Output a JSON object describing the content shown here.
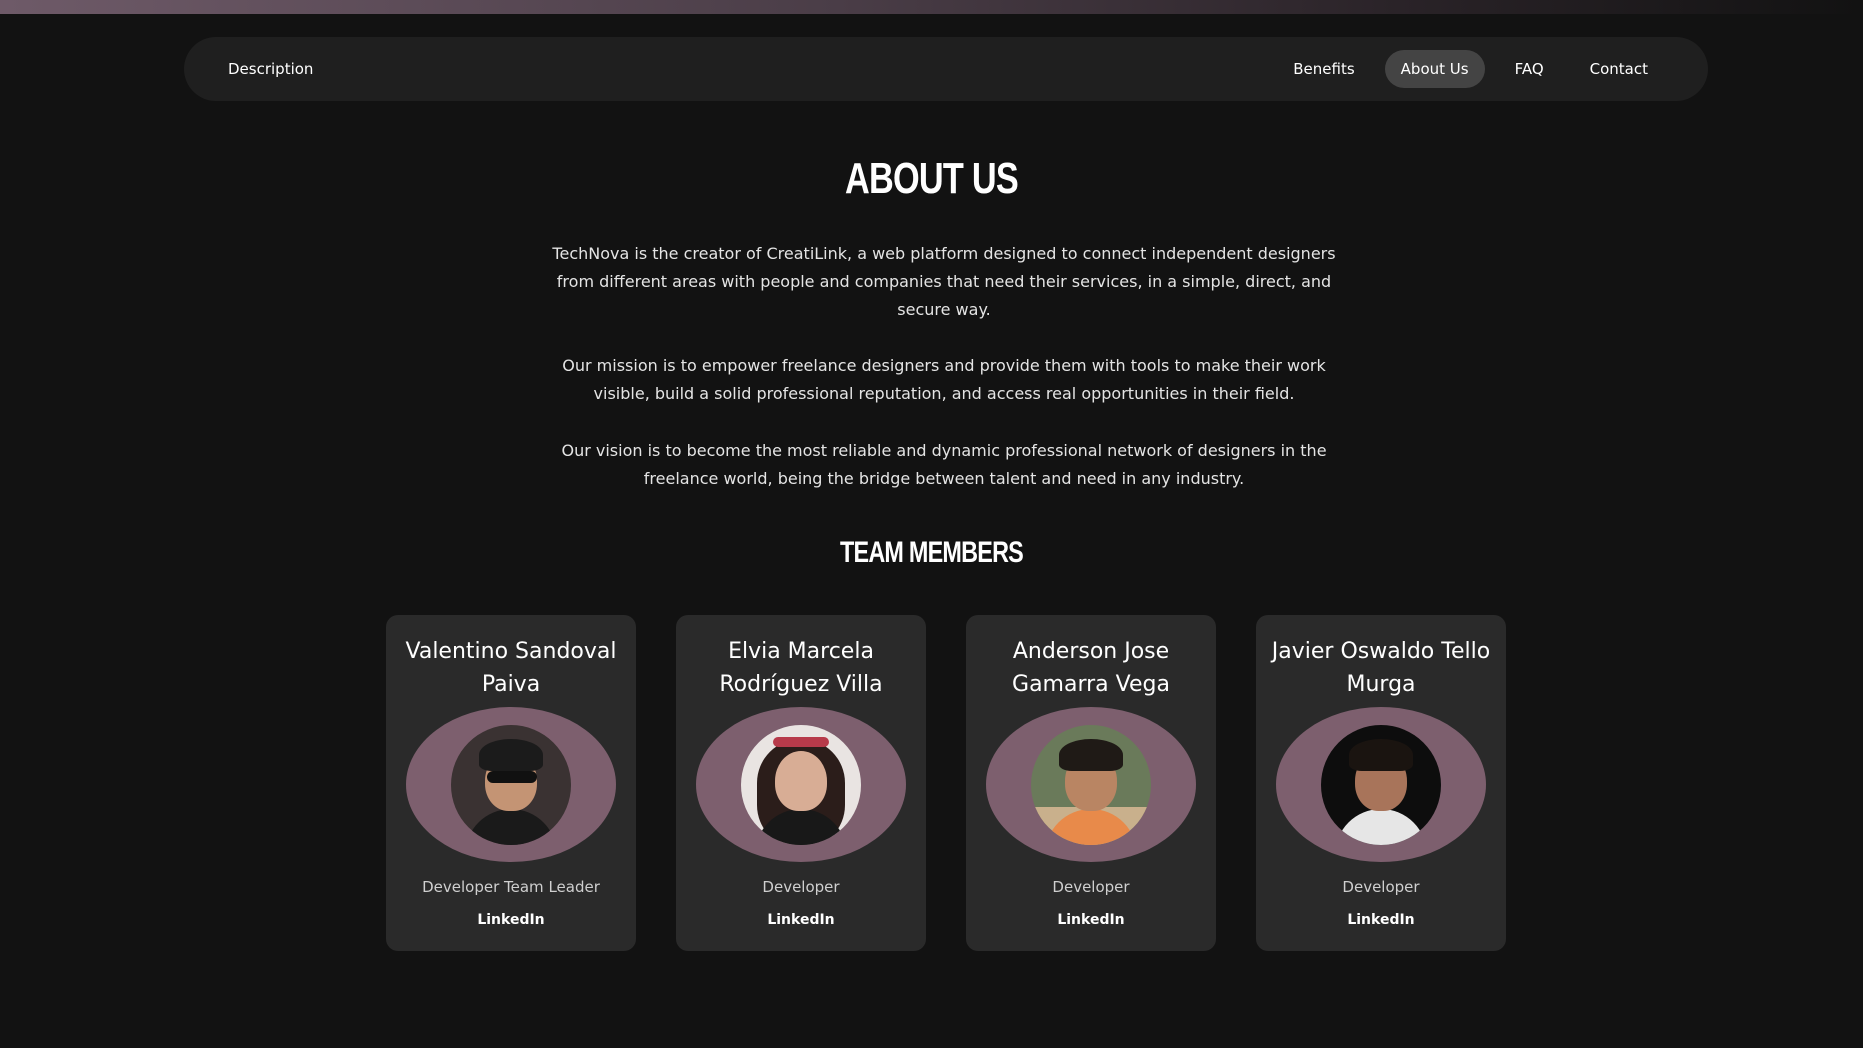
{
  "nav": {
    "left_label": "Description",
    "items": [
      {
        "label": "Benefits"
      },
      {
        "label": "About Us",
        "active": true
      },
      {
        "label": "FAQ"
      },
      {
        "label": "Contact"
      }
    ]
  },
  "about": {
    "title": "ABOUT US",
    "paragraphs": [
      "TechNova is the creator of CreatiLink, a web platform designed to connect independent designers from different areas with people and companies that need their services, in a simple, direct, and secure way.",
      "Our mission is to empower freelance designers and provide them with tools to make their work visible, build a solid professional reputation, and access real opportunities in their field.",
      "Our vision is to become the most reliable and dynamic professional network of designers in the freelance world, being the bridge between talent and need in any industry."
    ]
  },
  "team": {
    "title": "TEAM MEMBERS",
    "members": [
      {
        "name": "Valentino Sandoval Paiva",
        "role": "Developer Team Leader",
        "link": "LinkedIn"
      },
      {
        "name": "Elvia Marcela Rodríguez Villa",
        "role": "Developer",
        "link": "LinkedIn"
      },
      {
        "name": "Anderson Jose Gamarra Vega",
        "role": "Developer",
        "link": "LinkedIn"
      },
      {
        "name": "Javier Oswaldo Tello Murga",
        "role": "Developer",
        "link": "LinkedIn"
      }
    ]
  },
  "colors": {
    "background": "#121212",
    "navbar": "#1f1f1f",
    "active_pill": "#444444",
    "card": "#2a2a2a",
    "photo_ring": "#7d5f6e"
  }
}
